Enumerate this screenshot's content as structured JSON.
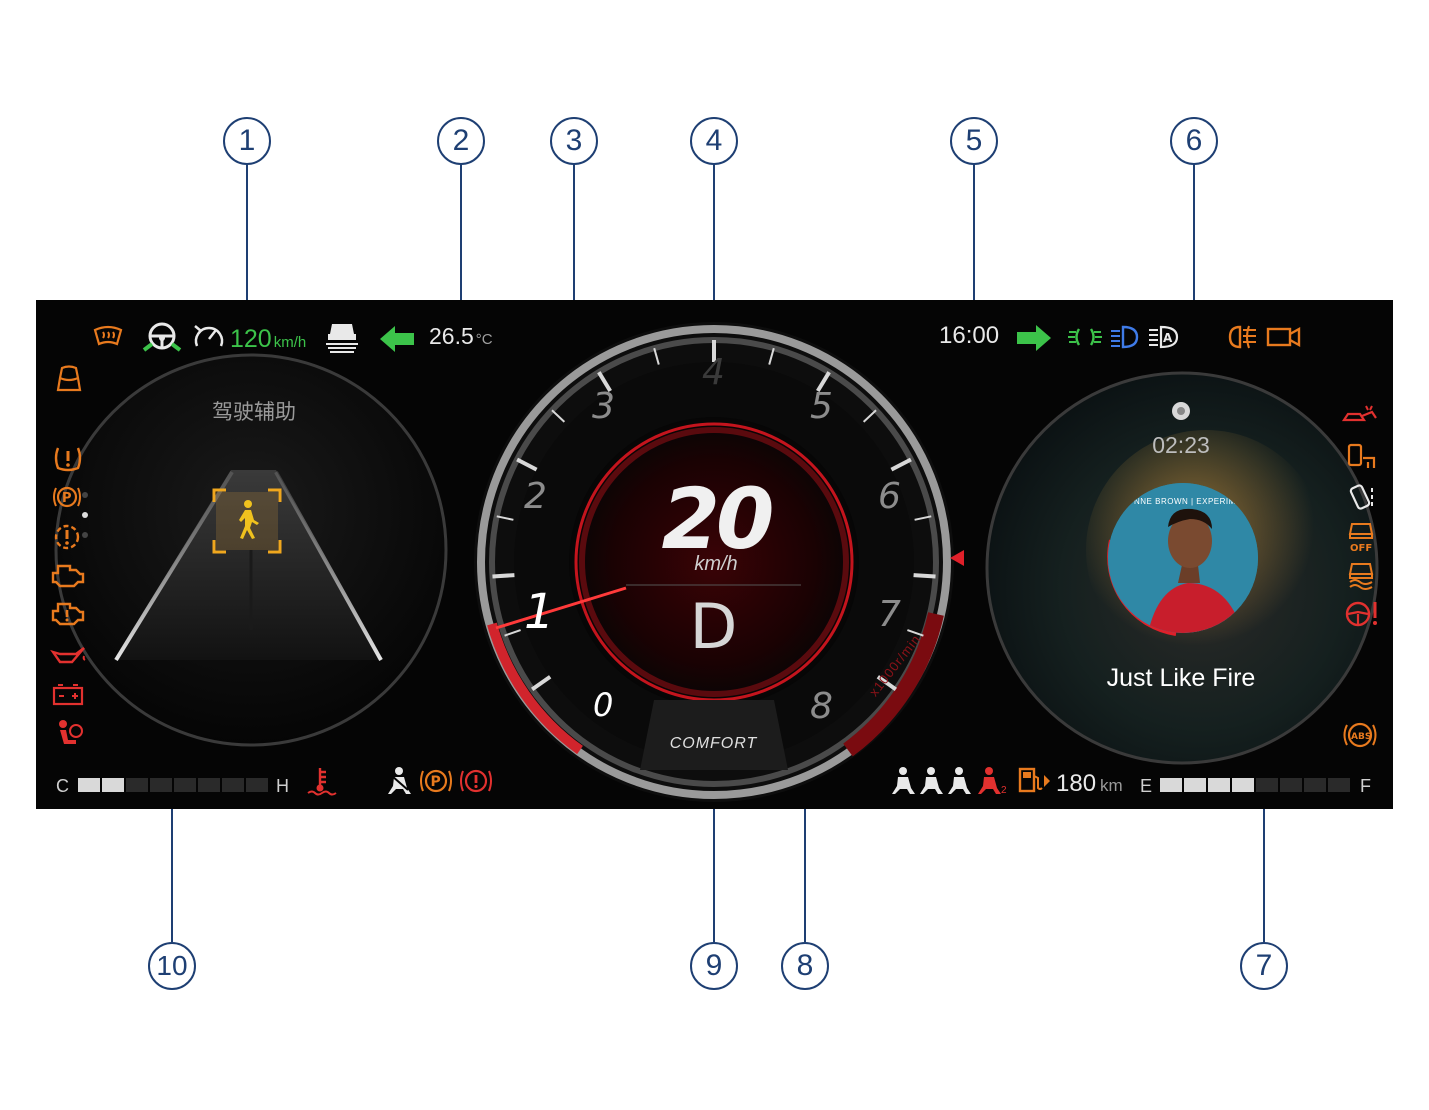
{
  "callouts": [
    "1",
    "2",
    "3",
    "4",
    "5",
    "6",
    "7",
    "8",
    "9",
    "10"
  ],
  "top_bar": {
    "cruise_speed": "120",
    "cruise_unit": "km/h",
    "outside_temp": "26.5",
    "temp_unit": "°C",
    "clock": "16:00"
  },
  "left_panel": {
    "title": "驾驶辅助",
    "temp_gauge": {
      "low_label": "C",
      "high_label": "H",
      "level": 0.3
    }
  },
  "center_gauge": {
    "speed": "20",
    "speed_unit": "km/h",
    "gear": "D",
    "drive_mode": "COMFORT",
    "rpm_unit": "x1000r/min",
    "rpm_ticks": [
      "0",
      "1",
      "2",
      "3",
      "4",
      "5",
      "6",
      "7",
      "8"
    ],
    "rpm_value": 1
  },
  "right_panel": {
    "track_time": "02:23",
    "track_title": "Just Like Fire",
    "album_text": "NNE BROWN | EXPERIMEN",
    "range": "180",
    "range_unit": "km",
    "fuel_gauge": {
      "low_label": "E",
      "high_label": "F",
      "level": 0.45
    },
    "seat_number": "2"
  },
  "colors": {
    "warning_orange": "#e87a1e",
    "warning_red": "#e2312f",
    "indicator_green": "#3cc34a",
    "indicator_blue": "#3f7be8",
    "accent_red": "#e0202a",
    "callout_blue": "#1e3f73"
  },
  "icons": [
    "windshield-defrost-icon",
    "steering-assist-icon",
    "cruise-control-icon",
    "lane-assist-icon",
    "left-turn-icon",
    "right-turn-icon",
    "position-lamp-icon",
    "low-beam-icon",
    "auto-high-beam-icon",
    "rear-fog-icon",
    "dashcam-icon",
    "seat-icon",
    "tpms-icon",
    "epb-icon",
    "powertrain-fault-icon",
    "engine-check-icon",
    "engine-fault-icon",
    "oil-pressure-icon",
    "battery-icon",
    "airbag-icon",
    "coolant-temp-icon",
    "seatbelt-icon",
    "parking-brake-icon",
    "brake-warning-icon",
    "collision-warning-icon",
    "door-open-icon",
    "key-icon",
    "esp-off-icon",
    "esp-icon",
    "steering-fault-icon",
    "abs-icon",
    "fuel-icon",
    "media-source-icon",
    "pedestrian-icon"
  ]
}
